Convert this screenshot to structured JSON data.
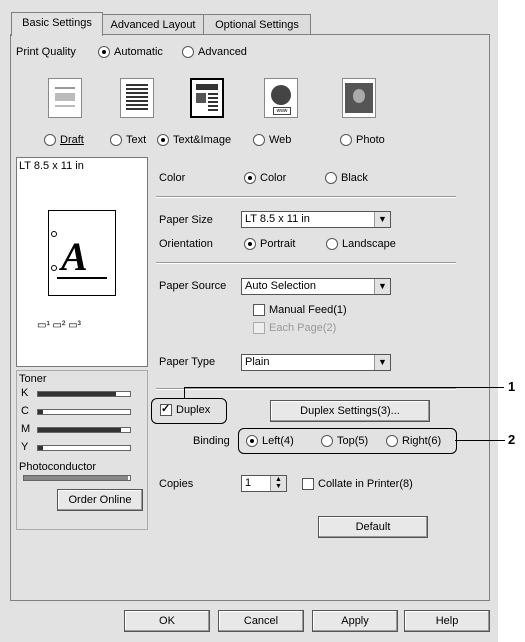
{
  "tabs": [
    "Basic Settings",
    "Advanced Layout",
    "Optional Settings"
  ],
  "print_quality": {
    "label": "Print Quality",
    "mode_options": [
      "Automatic",
      "Advanced"
    ],
    "mode_selected": "Automatic",
    "presets": [
      "Draft",
      "Text",
      "Text&Image",
      "Web",
      "Photo"
    ],
    "preset_selected": "Text&Image"
  },
  "preview": {
    "paper_label": "LT 8.5 x 11 in"
  },
  "color": {
    "label": "Color",
    "options": [
      "Color",
      "Black"
    ],
    "selected": "Color"
  },
  "paper_size": {
    "label": "Paper Size",
    "value": "LT 8.5 x 11 in"
  },
  "orientation": {
    "label": "Orientation",
    "options": [
      "Portrait",
      "Landscape"
    ],
    "selected": "Portrait"
  },
  "paper_source": {
    "label": "Paper Source",
    "value": "Auto Selection",
    "manual_feed": "Manual Feed(1)",
    "each_page": "Each Page(2)"
  },
  "paper_type": {
    "label": "Paper Type",
    "value": "Plain"
  },
  "toner": {
    "label": "Toner",
    "levels": [
      {
        "name": "K",
        "level": 0.85
      },
      {
        "name": "C",
        "level": 0.05
      },
      {
        "name": "M",
        "level": 0.9
      },
      {
        "name": "Y",
        "level": 0.05
      }
    ],
    "photoconductor_label": "Photoconductor",
    "photoconductor_level": 0.98,
    "order_button": "Order Online"
  },
  "duplex": {
    "label": "Duplex",
    "checked": true,
    "settings_button": "Duplex Settings(3)...",
    "binding_label": "Binding",
    "binding_options": [
      "Left(4)",
      "Top(5)",
      "Right(6)"
    ],
    "binding_selected": "Left(4)"
  },
  "copies": {
    "label": "Copies",
    "value": "1",
    "collate": "Collate in Printer(8)"
  },
  "default_button": "Default",
  "footer": {
    "ok": "OK",
    "cancel": "Cancel",
    "apply": "Apply",
    "help": "Help"
  },
  "callouts": [
    "1",
    "2"
  ]
}
